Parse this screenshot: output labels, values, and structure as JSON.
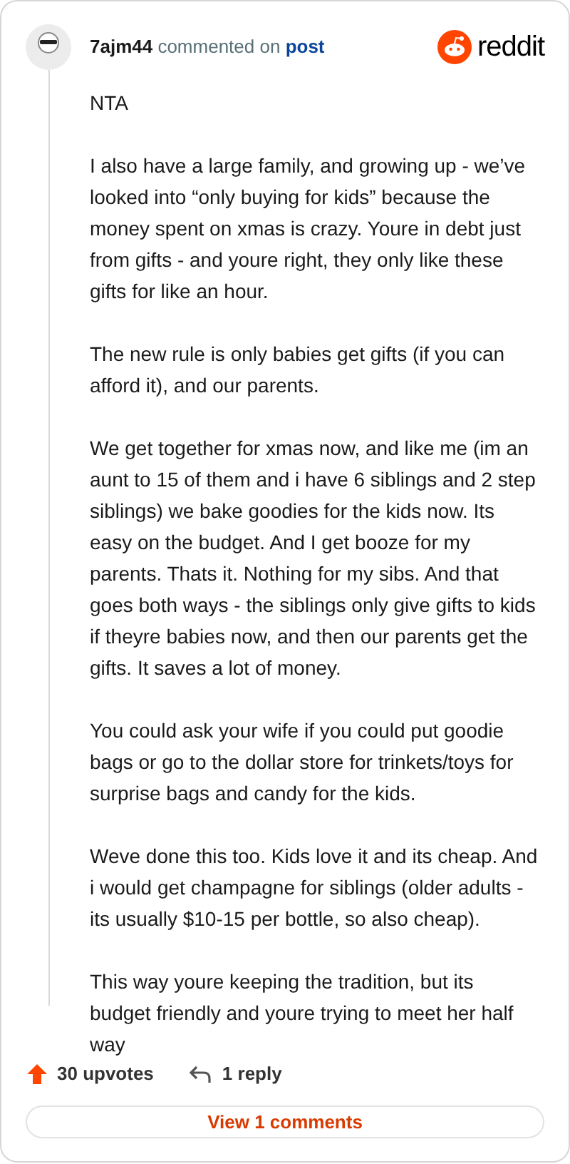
{
  "comment": {
    "author": "7ajm44",
    "action": "commented on",
    "target": "post"
  },
  "brand": "reddit",
  "paragraphs": [
    "NTA",
    "I also have a large family, and growing up - we’ve looked into “only buying for kids” because the money spent on xmas is crazy. Youre in debt just from gifts - and youre right, they only like these gifts for like an hour.",
    "The new rule is only babies get gifts (if you can afford it), and our parents.",
    "We get together for xmas now, and like me (im an aunt to 15 of them and i have 6 siblings and 2 step siblings) we bake goodies for the kids now. Its easy on the budget. And I get booze for my parents. Thats it. Nothing for my sibs. And that goes both ways - the siblings only give gifts to kids if theyre babies now, and then our parents get the gifts. It saves a lot of money.",
    "You could ask your wife if you could put goodie bags or go to the dollar store for trinkets/toys for surprise bags and candy for the kids.",
    "Weve done this too. Kids love it and its cheap. And i would get champagne for siblings (older adults - its usually $10-15 per bottle, so also cheap).",
    "This way youre keeping the tradition, but its budget friendly and youre trying to meet her half way"
  ],
  "upvotes": "30 upvotes",
  "replies": "1 reply",
  "view_button": "View 1 comments"
}
